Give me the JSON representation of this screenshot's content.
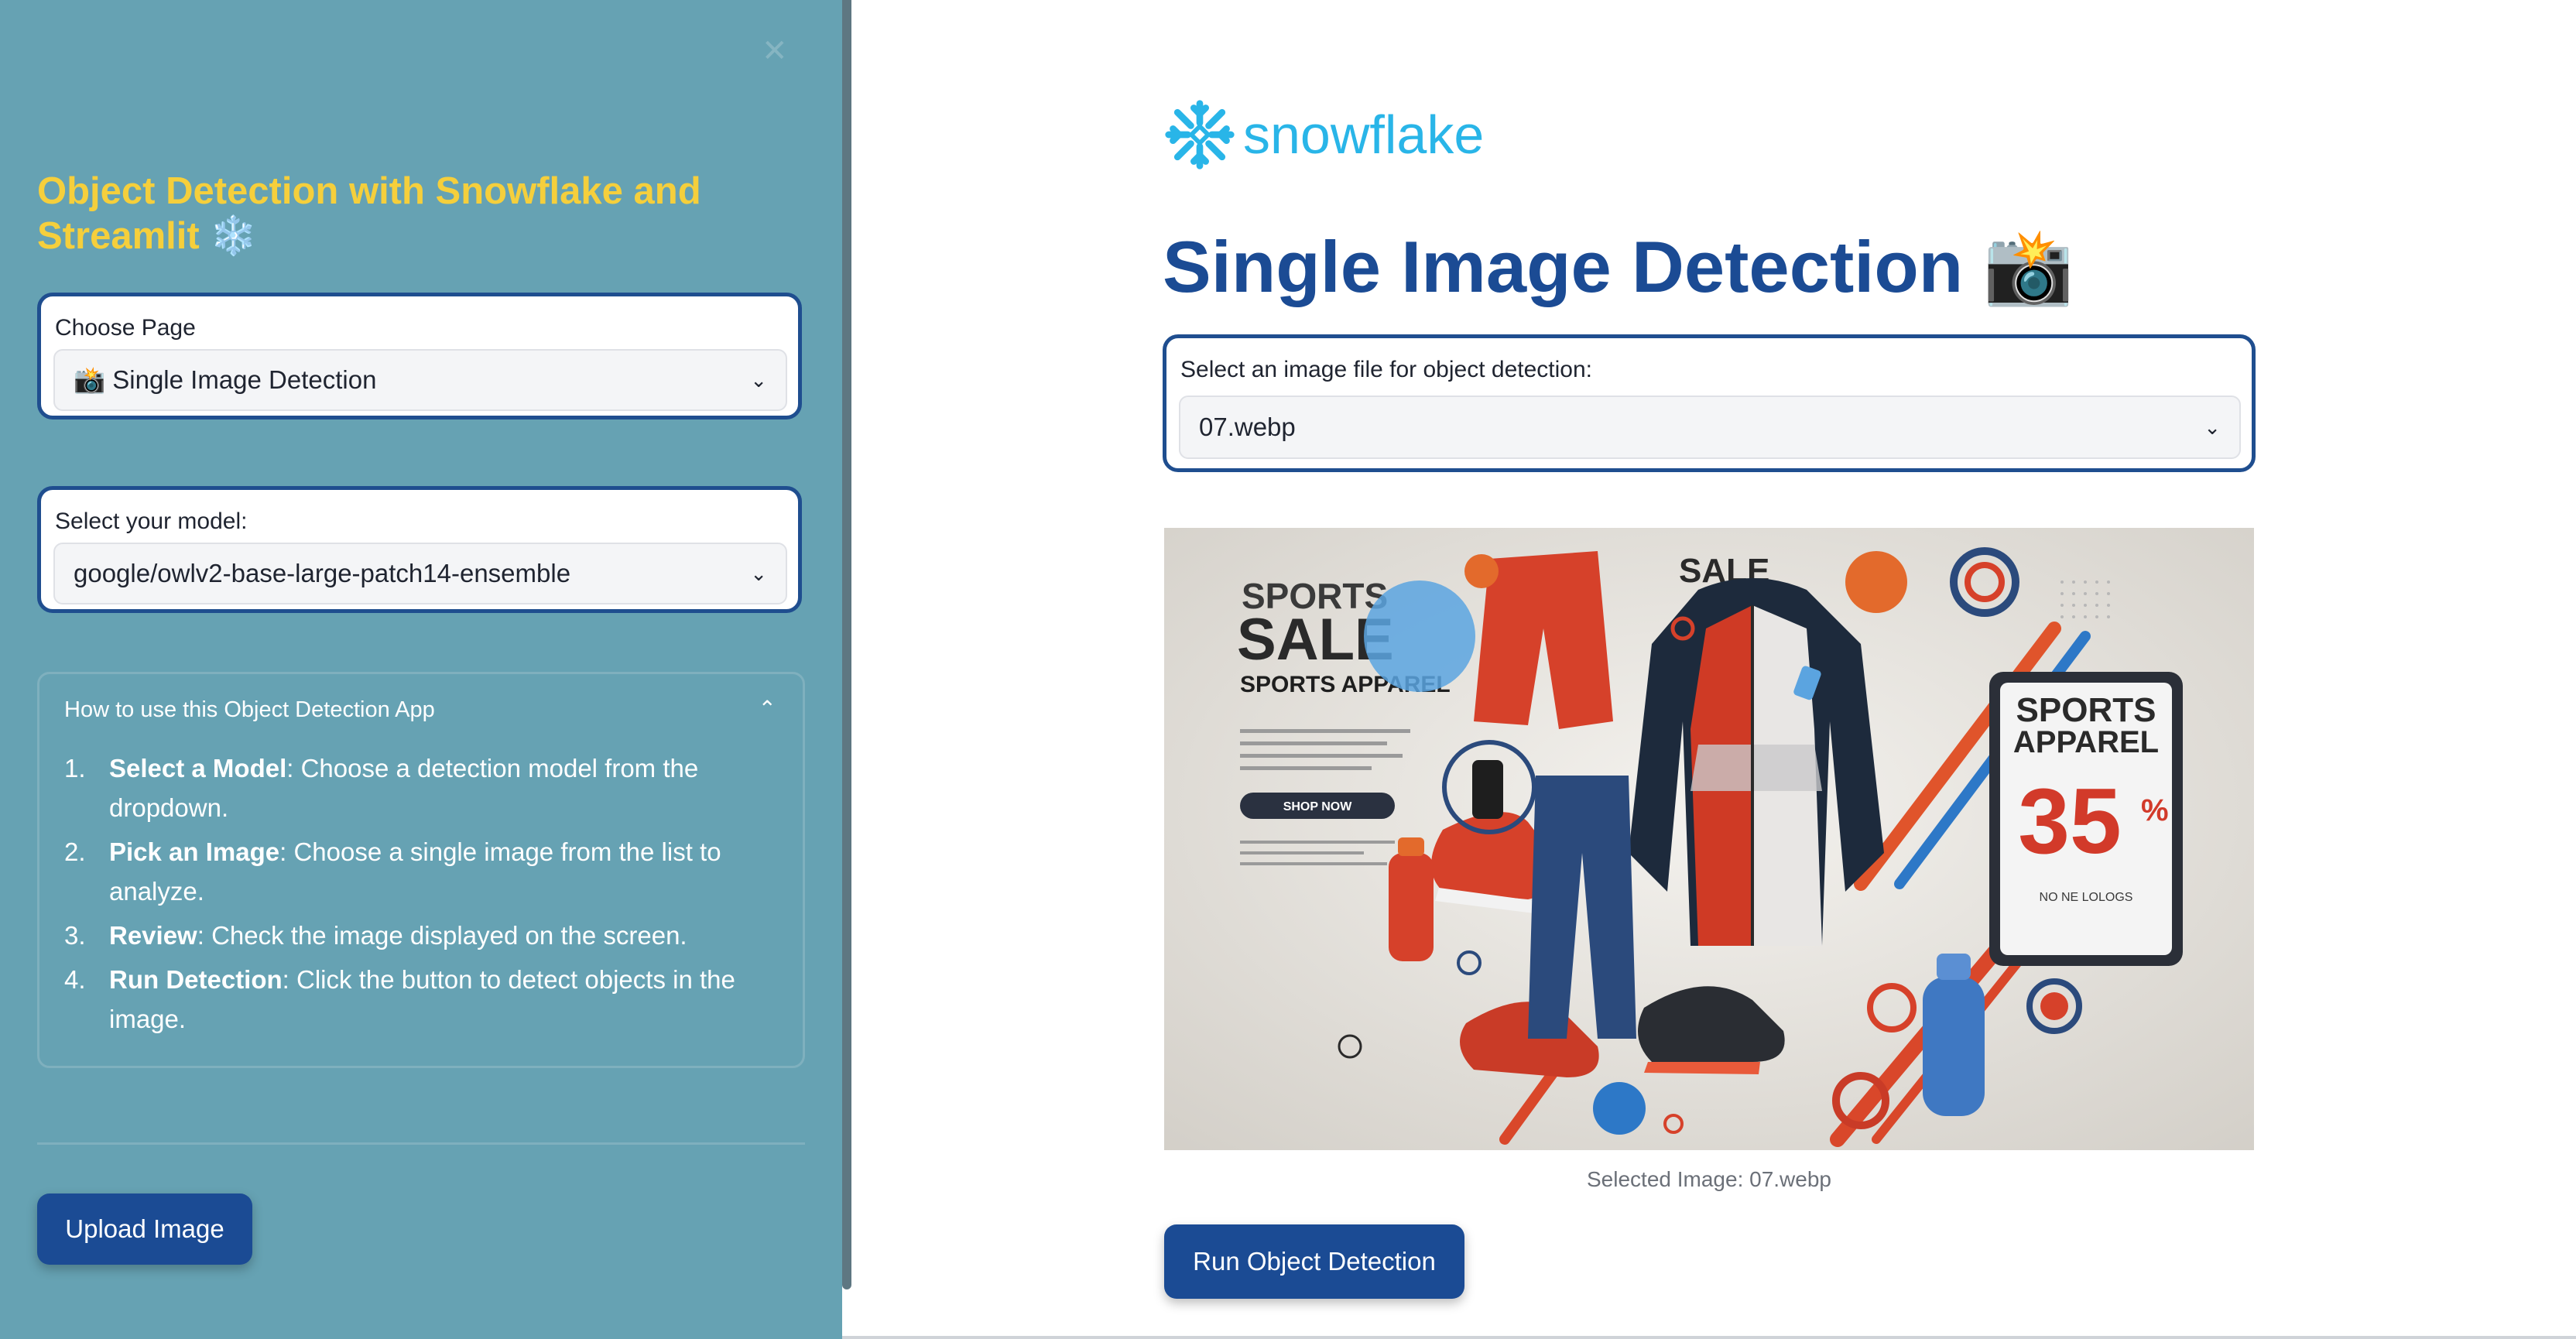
{
  "sidebar": {
    "title": "Object Detection with Snowflake and Streamlit ❄️",
    "close_icon": "close-icon",
    "page_select": {
      "label": "Choose Page",
      "value": "📸 Single Image Detection"
    },
    "model_select": {
      "label": "Select your model:",
      "value": "google/owlv2-base-large-patch14-ensemble"
    },
    "help": {
      "title": "How to use this Object Detection App",
      "expanded": true,
      "steps": [
        {
          "num": "1.",
          "bold": "Select a Model",
          "text": ": Choose a detection model from the dropdown."
        },
        {
          "num": "2.",
          "bold": "Pick an Image",
          "text": ": Choose a single image from the list to analyze."
        },
        {
          "num": "3.",
          "bold": "Review",
          "text": ": Check the image displayed on the screen."
        },
        {
          "num": "4.",
          "bold": "Run Detection",
          "text": ": Click the button to detect objects in the image."
        }
      ]
    },
    "upload_button": "Upload Image"
  },
  "main": {
    "logo_text": "snowflake",
    "title": "Single Image Detection 📸",
    "image_select": {
      "label": "Select an image file for object detection:",
      "value": "07.webp"
    },
    "poster": {
      "left_heading_1": "SPORTS",
      "left_heading_2": "SALE",
      "left_heading_3": "SPORTS APPAREL",
      "shop_button": "SHOP NOW",
      "top_sale": "SALE",
      "right_heading_1": "SPORTS",
      "right_heading_2": "APPAREL",
      "discount": "35",
      "discount_suffix": "%",
      "fine_print": "NO NE LOLOGS"
    },
    "caption": "Selected Image: 07.webp",
    "run_button": "Run Object Detection"
  },
  "colors": {
    "sidebar_bg": "#66a2b3",
    "title_yellow": "#f5cf3c",
    "primary_blue": "#1b4b94",
    "snowflake_blue": "#29b5e8"
  }
}
